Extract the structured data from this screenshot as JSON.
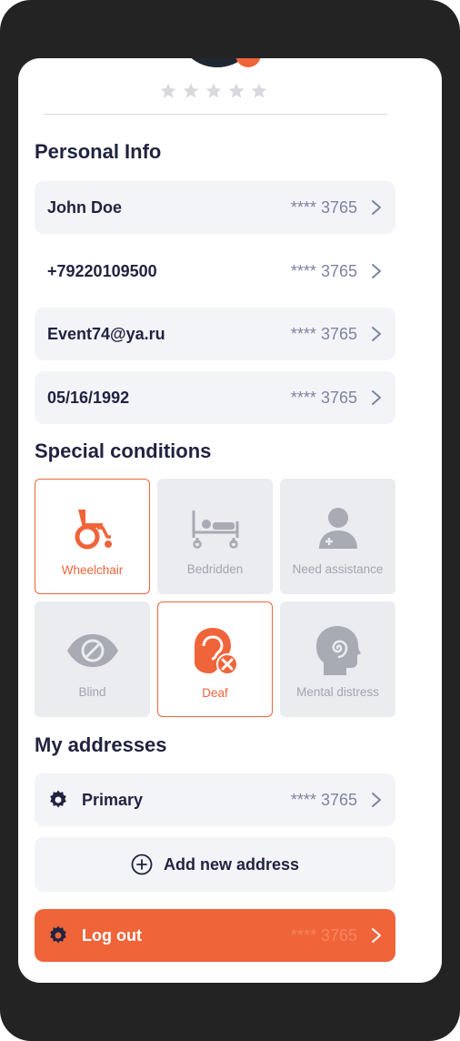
{
  "profile": {
    "rating_stars": 5,
    "rating_filled": 0
  },
  "personal_info": {
    "title": "Personal Info",
    "rows": [
      {
        "label": "John Doe",
        "masked": "**** 3765"
      },
      {
        "label": "+79220109500",
        "masked": "**** 3765"
      },
      {
        "label": "Event74@ya.ru",
        "masked": "**** 3765"
      },
      {
        "label": "05/16/1992",
        "masked": "**** 3765"
      }
    ]
  },
  "special_conditions": {
    "title": "Special conditions",
    "items": [
      {
        "label": "Wheelchair",
        "icon": "wheelchair-icon",
        "selected": true
      },
      {
        "label": "Bedridden",
        "icon": "bed-icon",
        "selected": false
      },
      {
        "label": "Need assistance",
        "icon": "medical-person-icon",
        "selected": false
      },
      {
        "label": "Blind",
        "icon": "eye-slash-icon",
        "selected": false
      },
      {
        "label": "Deaf",
        "icon": "ear-off-icon",
        "selected": true
      },
      {
        "label": "Mental distress",
        "icon": "head-spiral-icon",
        "selected": false
      }
    ]
  },
  "addresses": {
    "title": "My addresses",
    "items": [
      {
        "label": "Primary",
        "masked": "**** 3765",
        "icon": "gear-icon"
      }
    ],
    "add_label": "Add new address"
  },
  "logout": {
    "label": "Log out",
    "masked": "**** 3765"
  },
  "colors": {
    "accent": "#f0643a",
    "text_dark": "#1f2340",
    "row_bg": "#f3f4f8",
    "muted": "#7c84a0",
    "disabled_bg": "#ebecef",
    "disabled_text": "#a2a5ad"
  }
}
